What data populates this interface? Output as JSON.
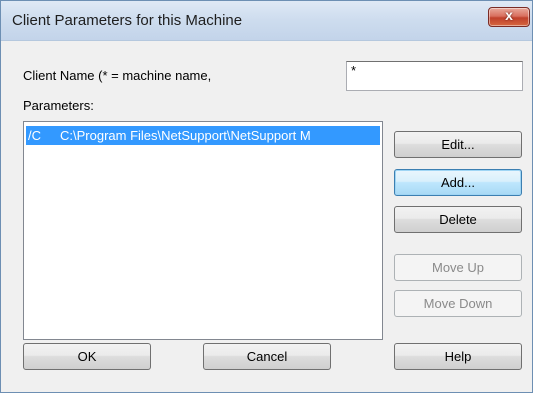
{
  "window": {
    "title": "Client Parameters for this Machine",
    "close_glyph": "x"
  },
  "client_name": {
    "label": "Client Name (* = machine name,",
    "value": "*"
  },
  "parameters": {
    "label": "Parameters:",
    "items": [
      {
        "switch": "/C",
        "value": "C:\\Program Files\\NetSupport\\NetSupport M"
      }
    ]
  },
  "side_buttons": {
    "edit": "Edit...",
    "add": "Add...",
    "delete": "Delete",
    "move_up": "Move Up",
    "move_down": "Move Down"
  },
  "bottom_buttons": {
    "ok": "OK",
    "cancel": "Cancel",
    "help": "Help"
  },
  "colors": {
    "selection": "#3399ff",
    "default_button": "#bee6fd"
  }
}
